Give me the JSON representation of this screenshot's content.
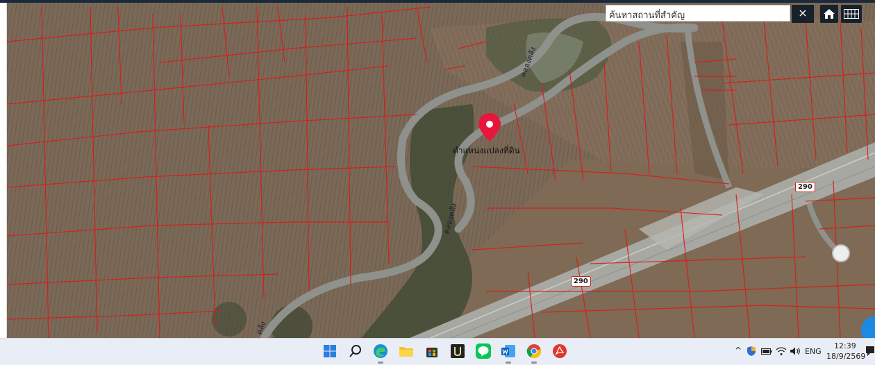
{
  "search": {
    "placeholder": "ค้นหาสถานที่สำคัญ",
    "clear_label": "×"
  },
  "map": {
    "parcel_label": "ตำแหน่งแปลงที่ดิน",
    "canal_labels": [
      "คลองคลัง",
      "คลองคลัง",
      "คลัง"
    ],
    "route_shields": [
      "290",
      "290"
    ]
  },
  "taskbar": {
    "language": "ENG",
    "time": "12:39",
    "date": "18/9/2569"
  }
}
